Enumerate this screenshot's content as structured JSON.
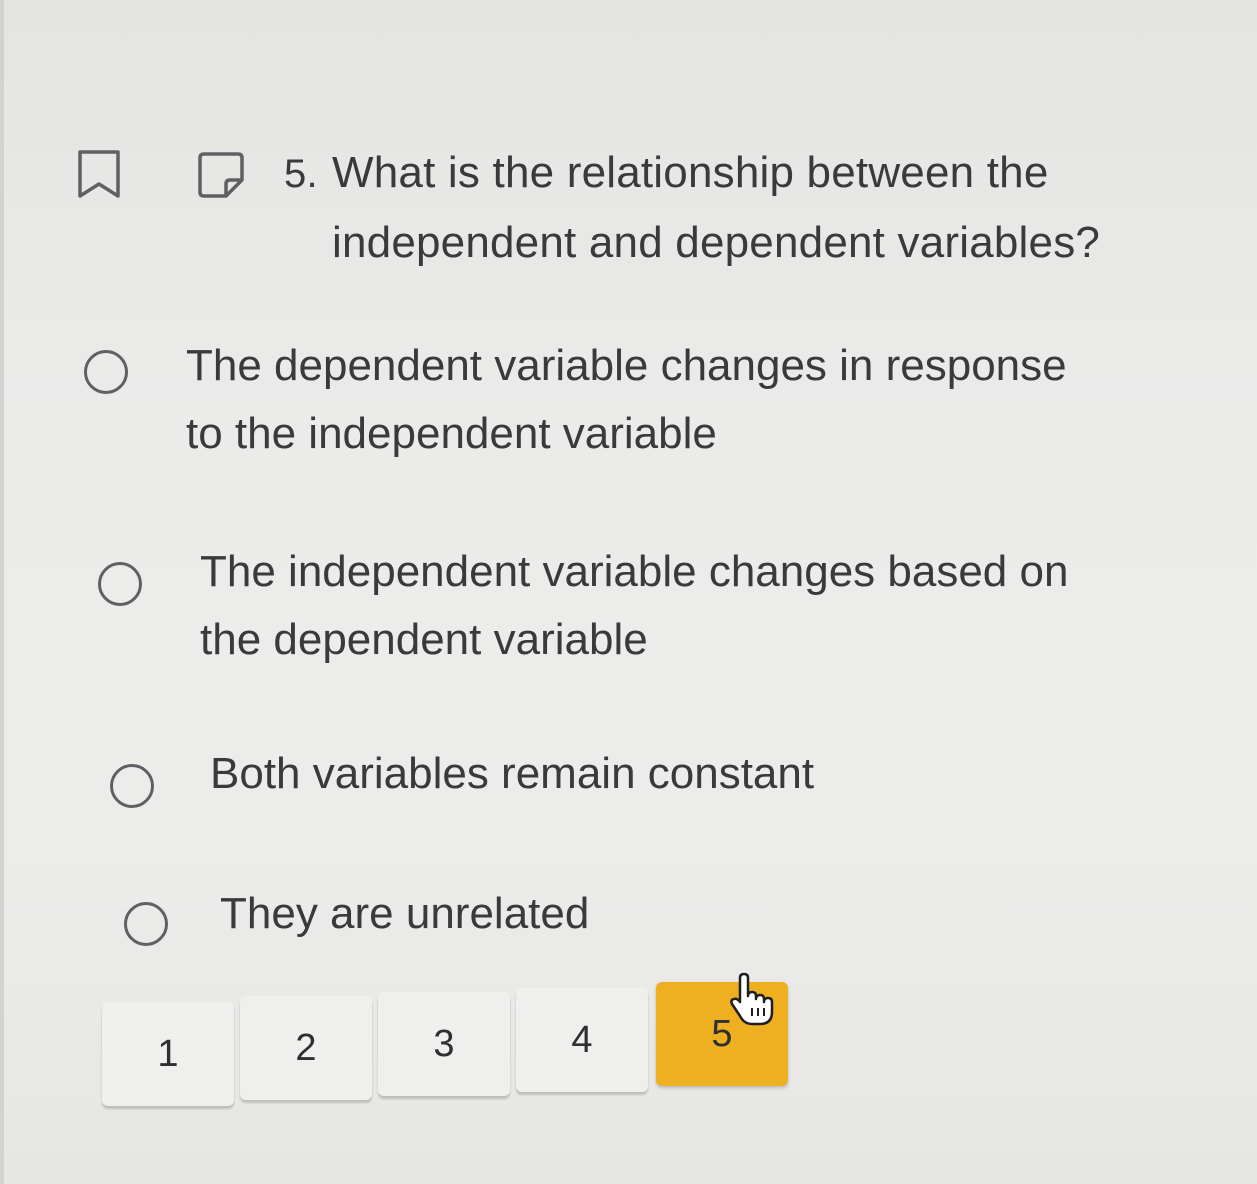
{
  "question": {
    "number": "5.",
    "text": "What is the relationship between the independent and dependent variables?"
  },
  "toolbar": {
    "bookmark_icon": "bookmark-icon",
    "note_icon": "note-icon"
  },
  "options": [
    {
      "label": "The dependent variable changes in response to the independent variable",
      "line1": "The dependent variable changes in response",
      "line2": "to the independent variable",
      "selected": false
    },
    {
      "label": "The independent variable changes based on the dependent variable",
      "line1": "The independent variable changes based on",
      "line2": "the dependent variable",
      "selected": false
    },
    {
      "label": "Both variables remain constant",
      "line1": "Both variables remain constant",
      "line2": "",
      "selected": false
    },
    {
      "label": "They are unrelated",
      "line1": "They are unrelated",
      "line2": "",
      "selected": false
    }
  ],
  "pagination": {
    "pages": [
      "1",
      "2",
      "3",
      "4",
      "5"
    ],
    "current": "5",
    "active_color": "#eeb020"
  },
  "cursor": "hand-pointer-icon"
}
